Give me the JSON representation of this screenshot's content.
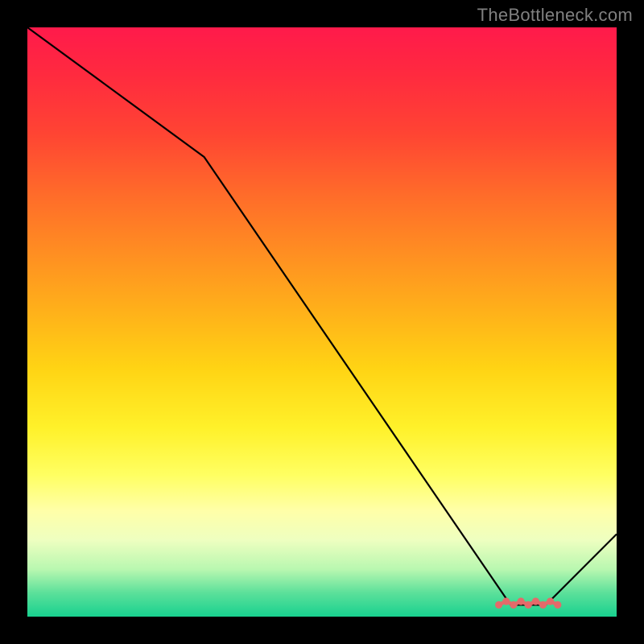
{
  "attribution": "TheBottleneck.com",
  "chart_data": {
    "type": "line",
    "title": "",
    "xlabel": "",
    "ylabel": "",
    "xlim": [
      0,
      100
    ],
    "ylim": [
      0,
      100
    ],
    "x": [
      0,
      30,
      82,
      88,
      100
    ],
    "values": [
      100,
      78,
      2,
      2,
      14
    ],
    "optimal_marker_x_range": [
      80,
      90
    ],
    "note": "values read as percentage of plot height from bottom; curve starts at top-left, slight slope break near x≈30, steep descent to a flat minimum around x≈82–88, then rises to lower-right edge"
  }
}
